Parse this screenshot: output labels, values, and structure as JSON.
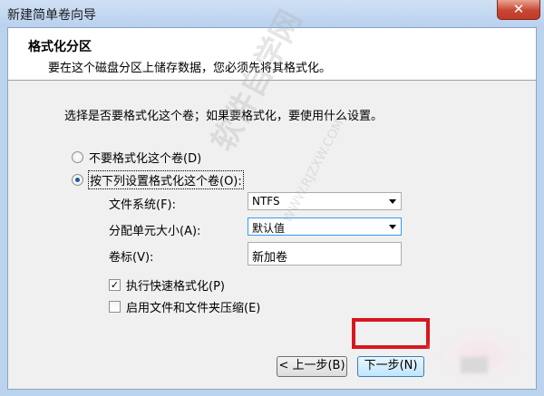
{
  "window": {
    "title": "新建简单卷向导",
    "close_glyph": "✕"
  },
  "header": {
    "title": "格式化分区",
    "description": "要在这个磁盘分区上储存数据，您必须先将其格式化。"
  },
  "prompt": "选择是否要格式化这个卷；如果要格式化，要使用什么设置。",
  "options": {
    "no_format": {
      "label": "不要格式化这个卷(D)",
      "selected": false
    },
    "format": {
      "label": "按下列设置格式化这个卷(O):",
      "selected": true
    }
  },
  "fields": {
    "file_system": {
      "label": "文件系统(F):",
      "value": "NTFS"
    },
    "allocation_unit": {
      "label": "分配单元大小(A):",
      "value": "默认值"
    },
    "volume_label": {
      "label": "卷标(V):",
      "value": "新加卷"
    }
  },
  "checkboxes": {
    "quick_format": {
      "label": "执行快速格式化(P)",
      "checked": true,
      "mark": "✓"
    },
    "compression": {
      "label": "启用文件和文件夹压缩(E)",
      "checked": false
    }
  },
  "buttons": {
    "back": "< 上一步(B)",
    "next": "下一步(N)"
  },
  "watermark": {
    "main": "软件自学网",
    "sub": "WWW.RJZXW.COM"
  }
}
